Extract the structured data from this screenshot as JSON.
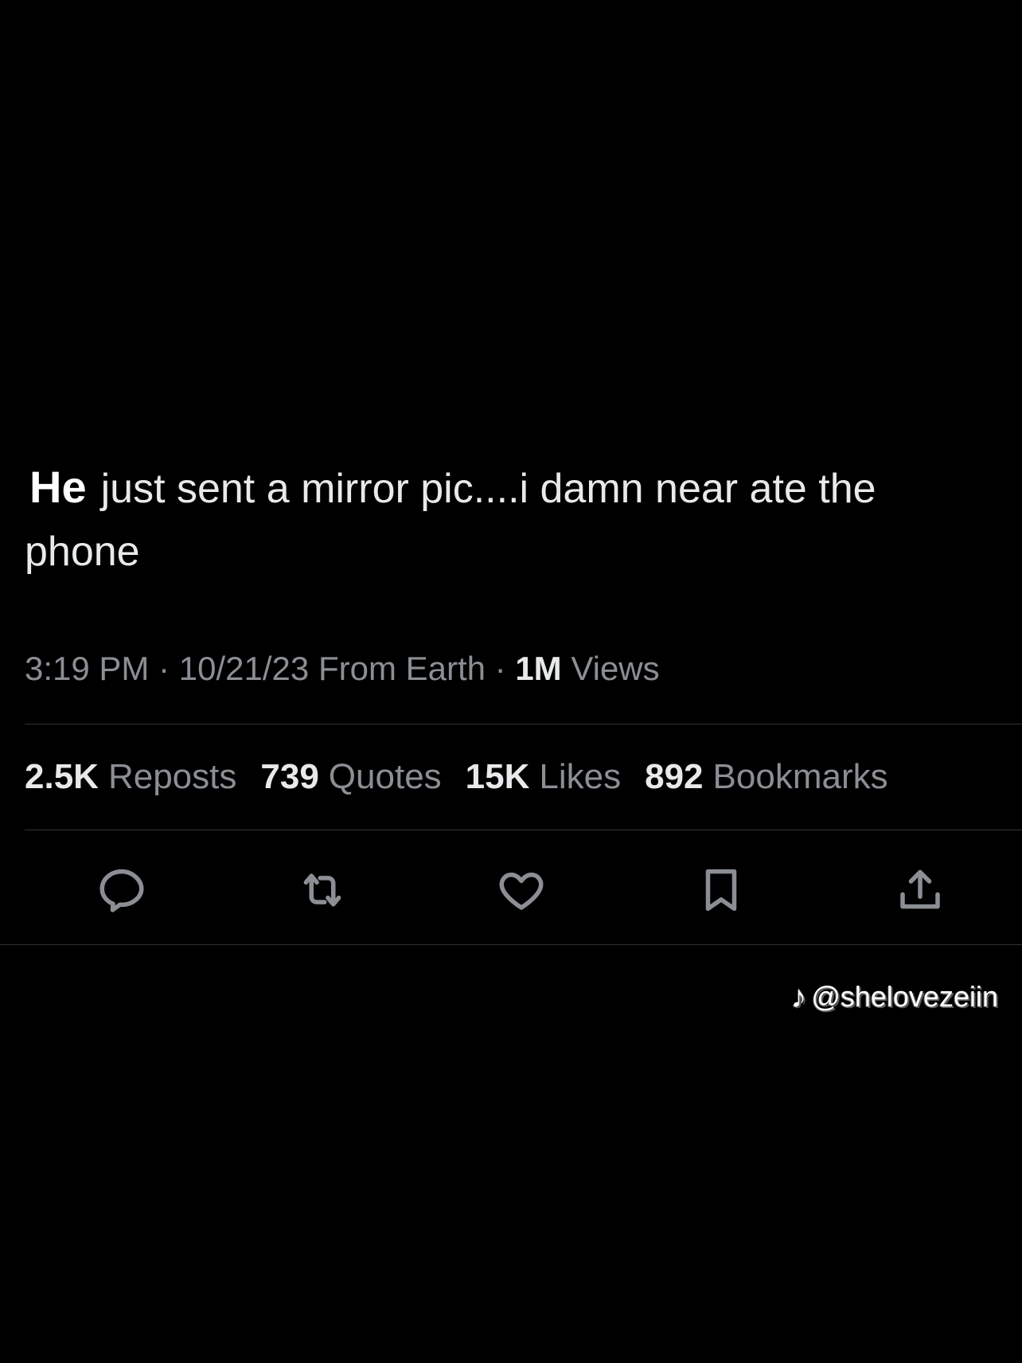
{
  "tweet": {
    "subject": "He",
    "text": "just sent a mirror pic....i damn near ate the phone"
  },
  "meta": {
    "time": "3:19 PM",
    "separator": "·",
    "date": "10/21/23",
    "source": "From Earth",
    "views_count": "1M",
    "views_label": "Views"
  },
  "stats": [
    {
      "count": "2.5K",
      "label": "Reposts"
    },
    {
      "count": "739",
      "label": "Quotes"
    },
    {
      "count": "15K",
      "label": "Likes"
    },
    {
      "count": "892",
      "label": "Bookmarks"
    }
  ],
  "actions": [
    {
      "name": "reply",
      "icon": "reply-icon"
    },
    {
      "name": "repost",
      "icon": "repost-icon"
    },
    {
      "name": "like",
      "icon": "heart-icon"
    },
    {
      "name": "bookmark",
      "icon": "bookmark-icon"
    },
    {
      "name": "share",
      "icon": "share-icon"
    }
  ],
  "watermark": {
    "icon": "tiktok-icon",
    "handle": "@shelovezeiin"
  },
  "colors": {
    "background": "#000000",
    "text_primary": "#e7e9ea",
    "text_secondary": "#8b8f94",
    "divider": "#2f3336"
  }
}
